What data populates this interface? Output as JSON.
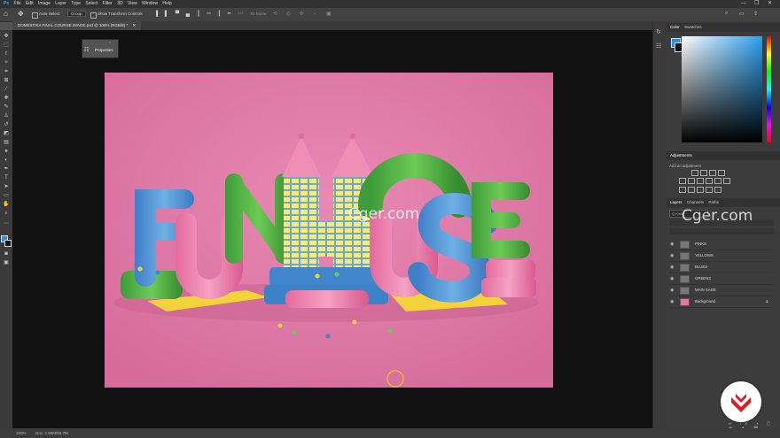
{
  "menu": [
    "Ps",
    "File",
    "Edit",
    "Image",
    "Layer",
    "Type",
    "Select",
    "Filter",
    "3D",
    "View",
    "Window",
    "Help"
  ],
  "options": {
    "auto_select_label": "Auto-Select:",
    "auto_select_value": "Group",
    "transform_label": "Show Transform Controls",
    "mode_3d": "3D Mode:"
  },
  "document_tab": "DOMESTIKA FINAL COURSE IMAGE.psd @ 100% (RGB/8) *",
  "properties_panel": {
    "label": "Properties"
  },
  "color_panel": {
    "tabs": [
      "Color",
      "Swatches"
    ]
  },
  "adjustments_panel": {
    "title": "Adjustments",
    "subtitle": "Add an adjustment"
  },
  "layers_panel": {
    "tabs": [
      "Layers",
      "Channels",
      "Paths"
    ],
    "search_placeholder": "Q Kind",
    "layers": [
      {
        "name": "PINKS"
      },
      {
        "name": "YELLOWS"
      },
      {
        "name": "BLUES"
      },
      {
        "name": "GREENS"
      },
      {
        "name": "MAIN SAGE"
      },
      {
        "name": "Background"
      }
    ]
  },
  "artwork": {
    "letters": [
      "F",
      "U",
      "N",
      "H",
      "O",
      "U",
      "S",
      "E"
    ]
  },
  "status": {
    "zoom": "100%",
    "doc": "Doc: 2.90M/56.7M"
  },
  "watermarks": [
    "Cger.com",
    "Cger.com"
  ],
  "colors": {
    "canvas_bg": "#e07aa6",
    "accent": "#d8202a"
  }
}
